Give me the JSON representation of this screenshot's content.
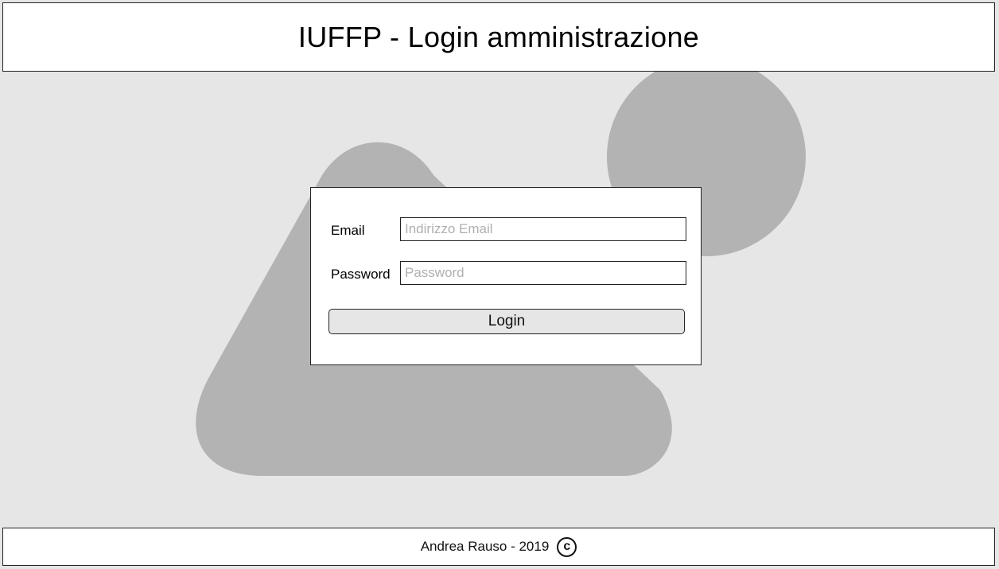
{
  "header": {
    "title": "IUFFP - Login amministrazione"
  },
  "login_form": {
    "email_label": "Email",
    "email_placeholder": "Indirizzo Email",
    "email_value": "",
    "password_label": "Password",
    "password_placeholder": "Password",
    "password_value": "",
    "login_button": "Login"
  },
  "footer": {
    "text": "Andrea Rauso - 2019",
    "icon": "copyright-icon"
  },
  "colors": {
    "background": "#e6e6e6",
    "shapes": "#b3b3b3",
    "panel": "#ffffff",
    "border": "#222222"
  }
}
